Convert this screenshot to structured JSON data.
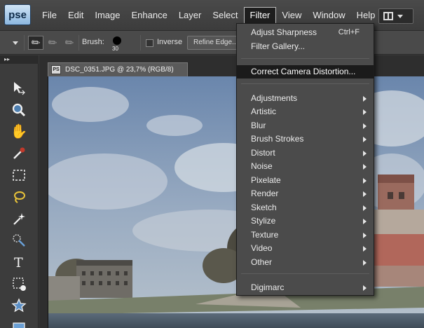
{
  "app": {
    "logo_text": "pse"
  },
  "menubar": {
    "items": [
      "File",
      "Edit",
      "Image",
      "Enhance",
      "Layer",
      "Select",
      "Filter",
      "View",
      "Window",
      "Help"
    ],
    "active": "Filter"
  },
  "options": {
    "brush_label": "Brush:",
    "brush_size": "30",
    "inverse_label": "Inverse",
    "refine_label": "Refine Edge..."
  },
  "toolbox": {
    "tools": [
      "move-tool",
      "zoom-tool",
      "hand-tool",
      "eyedropper-tool",
      "marquee-tool",
      "lasso-tool",
      "magic-wand-tool",
      "quick-selection-tool",
      "type-tool",
      "crop-tool",
      "shape-tool"
    ]
  },
  "document": {
    "tab_title": "DSC_0351.JPG @ 23,7% (RGB/8)",
    "icon_text": "PS"
  },
  "filter_menu": {
    "adjust_sharpness": "Adjust Sharpness",
    "adjust_sharpness_shortcut": "Ctrl+F",
    "filter_gallery": "Filter Gallery...",
    "correct_distortion": "Correct Camera Distortion...",
    "submenus": [
      "Adjustments",
      "Artistic",
      "Blur",
      "Brush Strokes",
      "Distort",
      "Noise",
      "Pixelate",
      "Render",
      "Sketch",
      "Stylize",
      "Texture",
      "Video",
      "Other"
    ],
    "digimarc": "Digimarc"
  },
  "colors": {
    "menu_bg": "#3f3f3f",
    "dropdown_bg": "#4b4b4b",
    "highlight": "#1b1b1b"
  }
}
